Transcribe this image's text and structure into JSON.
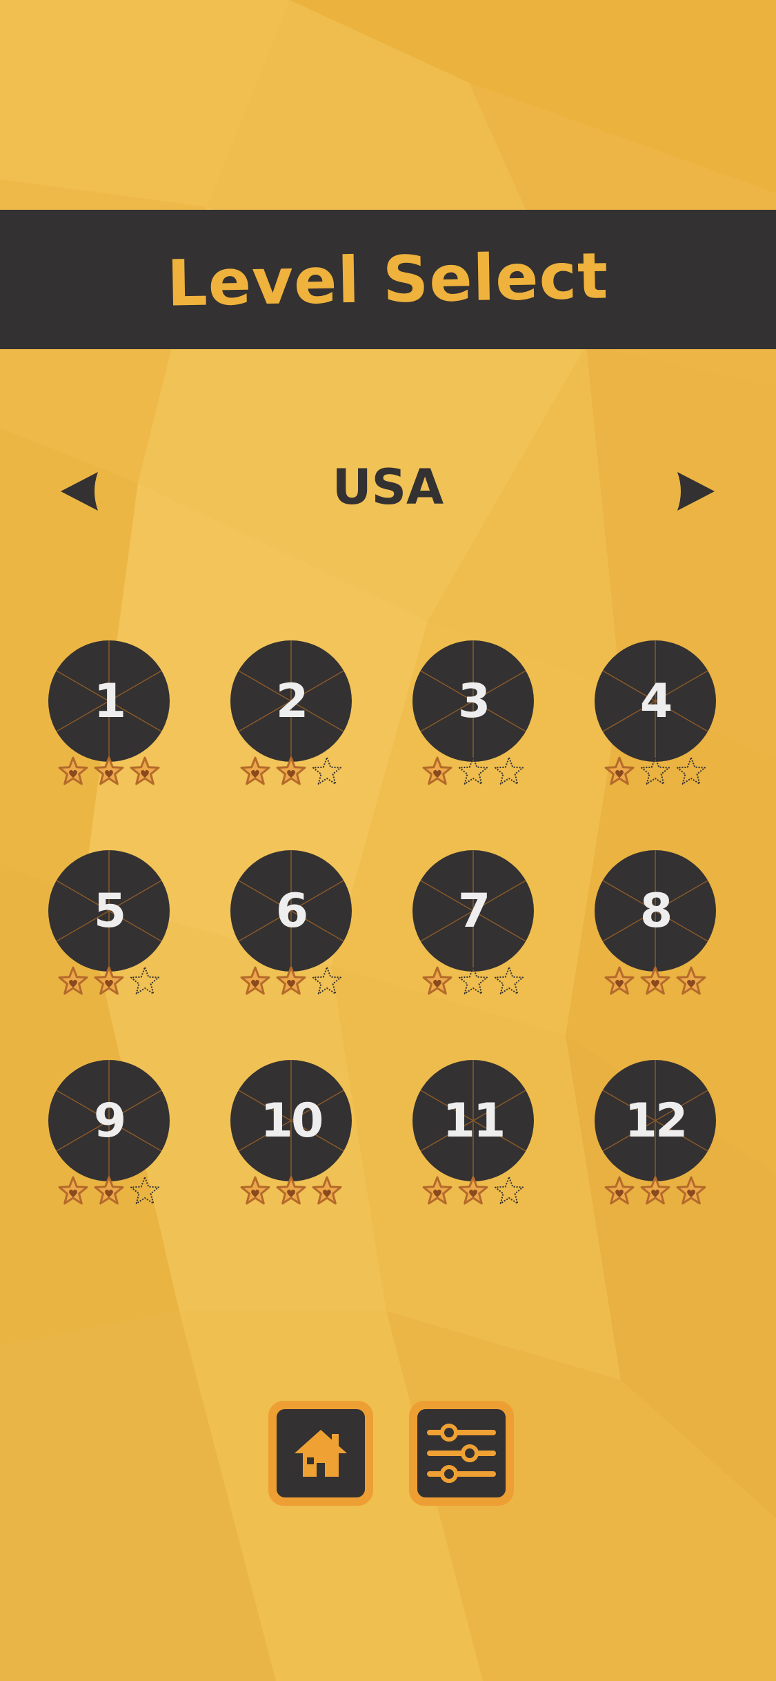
{
  "header": {
    "title": "Level Select"
  },
  "world": {
    "name": "USA",
    "prev_icon": "triangle-left-icon",
    "next_icon": "triangle-right-icon"
  },
  "levels": [
    {
      "number": "1",
      "stars": 3
    },
    {
      "number": "2",
      "stars": 2
    },
    {
      "number": "3",
      "stars": 1
    },
    {
      "number": "4",
      "stars": 1
    },
    {
      "number": "5",
      "stars": 2
    },
    {
      "number": "6",
      "stars": 2
    },
    {
      "number": "7",
      "stars": 1
    },
    {
      "number": "8",
      "stars": 3
    },
    {
      "number": "9",
      "stars": 2
    },
    {
      "number": "10",
      "stars": 3
    },
    {
      "number": "11",
      "stars": 2
    },
    {
      "number": "12",
      "stars": 3
    }
  ],
  "max_stars": 3,
  "footer": {
    "home_icon": "home-icon",
    "settings_icon": "sliders-icon"
  },
  "colors": {
    "background": "#efbd4d",
    "dark": "#333131",
    "accent": "#efb23c",
    "star_fill": "#eda84a",
    "star_outline": "#b36a2a",
    "button_frame": "#ee9f34"
  }
}
